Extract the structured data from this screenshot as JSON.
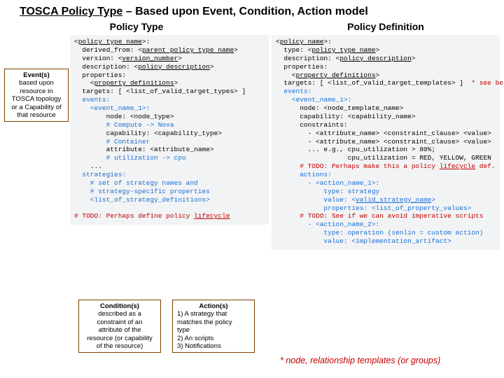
{
  "title_a": "TOSCA Policy Type",
  "title_b": " – Based upon Event, Condition, Action model",
  "headers": {
    "left": "Policy Type",
    "right": "Policy Definition"
  },
  "events_box_hd": "Event(s)",
  "events_box_body": "based upon\nresource in\nTOSCA topology\nor a Capability of\nthat resource",
  "cond_box_hd": "Condition(s)",
  "cond_box_body": "described as a\nconstraint of an\nattribute of the\nresource (or capability\nof the resource)",
  "act_box_hd": "Action(s)",
  "act_box_body": "1) A strategy that\nmatches the policy\ntype\n2) An scripts\n3) Notifications",
  "footnote": "* node, relationship templates (or groups)",
  "pt": {
    "l1a": "<",
    "l1b": "policy type name",
    "l1c": ">:",
    "l2a": "  derived_from: <",
    "l2b": "parent policy type name",
    "l2c": ">",
    "l3a": "  version: <",
    "l3b": "version_number",
    "l3c": ">",
    "l4a": "  description: <",
    "l4b": "policy description",
    "l4c": ">",
    "l5": "  properties:",
    "l6a": "    <",
    "l6b": "property definitions",
    "l6c": ">",
    "l7": "  targets: [ <list_of_valid_target_types> ]",
    "l8": "  events:",
    "l9": "    <event_name_1>:",
    "l10": "        node: <node_type>",
    "l11": "        # Compute -> Nova",
    "l12": "        capability: <capability_type>",
    "l13": "        # Container",
    "l14": "        attribute: <attribute_name>",
    "l15": "        # utilization -> cpu",
    "l16": "    ...",
    "l17": "  strategies:",
    "l18": "    # set of strategy names and",
    "l19": "    # strategy-specific properties",
    "l20": "    <list_of_strategy_definitions>",
    "l21a": "# TODO: Perhaps define policy ",
    "l21b": "lifecycle"
  },
  "pd": {
    "l1a": "<",
    "l1b": "policy name",
    "l1c": ">:",
    "l2a": "  type: <",
    "l2b": "policy type name",
    "l2c": ">",
    "l3a": "  description: <",
    "l3b": "policy description",
    "l3c": ">",
    "l4": "  properties:",
    "l5a": "    <",
    "l5b": "property definitions",
    "l5c": ">",
    "l6a": "  targets: [ <list_of_valid_target_templates> ]  ",
    "l6b": "* see below",
    "l7": "  events:",
    "l8": "    <event_name_1>:",
    "l9": "      node: <node_template_name>",
    "l10": "      capability: <capability_name>",
    "l11": "      constraints:",
    "l12": "        - <attribute_name> <constraint_clause> <value>",
    "l13": "        - <attribute_name> <constraint_clause> <value>",
    "l14": "        ... e.g., cpu_utilization > 80%;",
    "l15": "                  cpu_utilization = RED, YELLOW, GREEN",
    "l16a": "      # TODO: Perhaps make this a policy ",
    "l16b": "lifecycle",
    "l16c": " def.",
    "l17": "      actions:",
    "l18": "        - <action_name_1>:",
    "l19": "            type: strategy",
    "l20a": "            value: <",
    "l20b": "valid_strategy_name",
    "l20c": ">",
    "l21": "            properties: <list_of_property_values>",
    "l22": "      # TODO: See if we can avoid imperative scripts",
    "l23": "        - <action_name_2>:",
    "l24": "            type: operation (senlin = custom action)",
    "l25": "            value: <implementation_artifact>"
  }
}
